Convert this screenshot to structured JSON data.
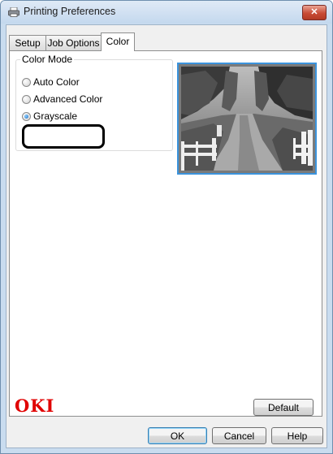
{
  "window": {
    "title": "Printing Preferences",
    "close_icon": "close-icon",
    "title_icon": "printer-icon",
    "close_color": "#c84b35"
  },
  "tabs": [
    {
      "label": "Setup",
      "active": false
    },
    {
      "label": "Job Options",
      "active": false
    },
    {
      "label": "Color",
      "active": true
    }
  ],
  "color_mode": {
    "group_title": "Color Mode",
    "options": [
      {
        "label": "Auto Color",
        "selected": false
      },
      {
        "label": "Advanced Color",
        "selected": false
      },
      {
        "label": "Grayscale",
        "selected": true
      }
    ]
  },
  "preview": {
    "icon": "grayscale-preview-image"
  },
  "brand": {
    "logo": "OKI",
    "color": "#e00000"
  },
  "buttons": {
    "default_label": "Default",
    "ok_label": "OK",
    "cancel_label": "Cancel",
    "help_label": "Help"
  }
}
